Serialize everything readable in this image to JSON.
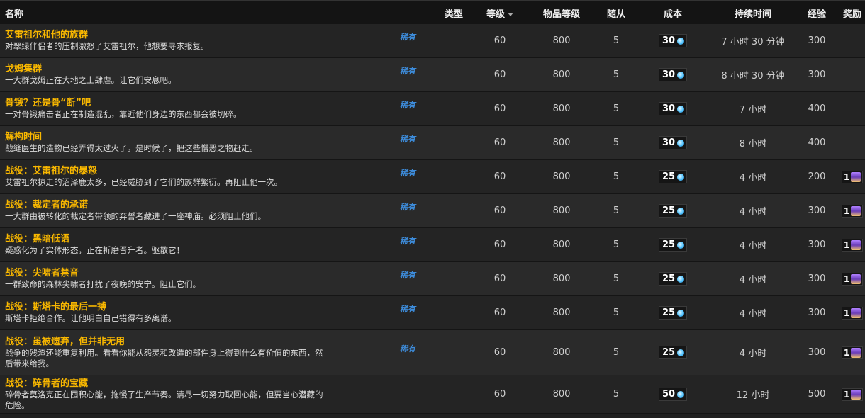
{
  "columns": {
    "name": "名称",
    "type": "类型",
    "level": "等级",
    "ilvl": "物品等级",
    "followers": "随从",
    "cost": "成本",
    "duration": "持续时间",
    "xp": "经验",
    "reward": "奖励"
  },
  "colors": {
    "title": "#f8b700",
    "rarity": "#3d8bd9",
    "header_bg": "#141414",
    "row_bg": "#242424"
  },
  "missions": [
    {
      "title": "艾雷祖尔和他的族群",
      "desc": "对翠绿伴侣者的压制激怒了艾雷祖尔，他想要寻求报复。",
      "rarity": "稀有",
      "level": "60",
      "ilvl": "800",
      "followers": "5",
      "cost": "30",
      "duration": "7 小时 30 分钟",
      "xp": "300",
      "reward": ""
    },
    {
      "title": "戈姆集群",
      "desc": "一大群戈姆正在大地之上肆虐。让它们安息吧。",
      "rarity": "稀有",
      "level": "60",
      "ilvl": "800",
      "followers": "5",
      "cost": "30",
      "duration": "8 小时 30 分钟",
      "xp": "300",
      "reward": ""
    },
    {
      "title": "骨锻？还是骨“断”吧",
      "desc": "一对骨锻痛击者正在制造混乱，靠近他们身边的东西都会被切碎。",
      "rarity": "稀有",
      "level": "60",
      "ilvl": "800",
      "followers": "5",
      "cost": "30",
      "duration": "7 小时",
      "xp": "400",
      "reward": ""
    },
    {
      "title": "解构时间",
      "desc": "战缝医生的造物已经弄得太过火了。是时候了，把这些憎恶之物赶走。",
      "rarity": "稀有",
      "level": "60",
      "ilvl": "800",
      "followers": "5",
      "cost": "30",
      "duration": "8 小时",
      "xp": "400",
      "reward": ""
    },
    {
      "title": "战役：艾雷祖尔的暴怒",
      "desc": "艾雷祖尔掠走的沼泽鹿太多，已经威胁到了它们的族群繁衍。再阻止他一次。",
      "rarity": "稀有",
      "level": "60",
      "ilvl": "800",
      "followers": "5",
      "cost": "25",
      "duration": "4 小时",
      "xp": "200",
      "reward": "1"
    },
    {
      "title": "战役：裁定者的承诺",
      "desc": "一大群由被转化的裁定者带领的弃誓者藏进了一座神庙。必须阻止他们。",
      "rarity": "稀有",
      "level": "60",
      "ilvl": "800",
      "followers": "5",
      "cost": "25",
      "duration": "4 小时",
      "xp": "300",
      "reward": "1"
    },
    {
      "title": "战役：黑暗低语",
      "desc": "疑惑化为了实体形态，正在折磨晋升者。驱散它！",
      "rarity": "稀有",
      "level": "60",
      "ilvl": "800",
      "followers": "5",
      "cost": "25",
      "duration": "4 小时",
      "xp": "300",
      "reward": "1"
    },
    {
      "title": "战役：尖啸者禁音",
      "desc": "一群致命的森林尖啸者打扰了夜晚的安宁。阻止它们。",
      "rarity": "稀有",
      "level": "60",
      "ilvl": "800",
      "followers": "5",
      "cost": "25",
      "duration": "4 小时",
      "xp": "300",
      "reward": "1"
    },
    {
      "title": "战役：斯塔卡的最后一搏",
      "desc": "斯塔卡拒绝合作。让他明白自己错得有多离谱。",
      "rarity": "稀有",
      "level": "60",
      "ilvl": "800",
      "followers": "5",
      "cost": "25",
      "duration": "4 小时",
      "xp": "300",
      "reward": "1"
    },
    {
      "title": "战役：虽被遗弃，但并非无用",
      "desc": "战争的残渣还能重复利用。看看你能从怨灵和改造的部件身上得到什么有价值的东西，然后带来给我。",
      "rarity": "稀有",
      "level": "60",
      "ilvl": "800",
      "followers": "5",
      "cost": "25",
      "duration": "4 小时",
      "xp": "300",
      "reward": "1"
    },
    {
      "title": "战役：碎骨者的宝藏",
      "desc": "碎骨者莫洛克正在囤积心能，拖慢了生产节奏。请尽一切努力取回心能，但要当心潜藏的危险。",
      "rarity": "",
      "level": "60",
      "ilvl": "800",
      "followers": "5",
      "cost": "50",
      "duration": "12 小时",
      "xp": "500",
      "reward": "1"
    }
  ]
}
